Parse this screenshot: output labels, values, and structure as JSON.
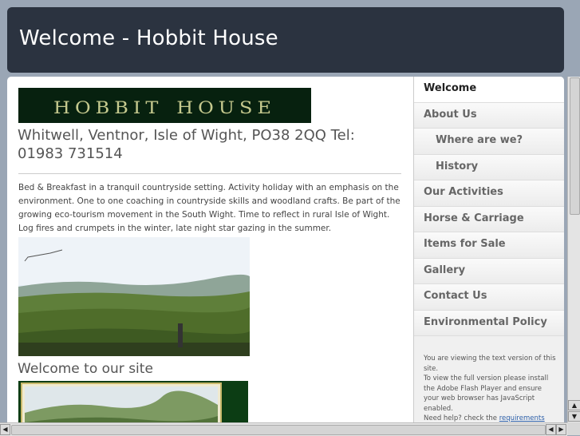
{
  "header": {
    "title": "Welcome - Hobbit House"
  },
  "logo": {
    "text": "hobbit house"
  },
  "address": "Whitwell, Ventnor, Isle of Wight, PO38 2QQ Tel: 01983 731514",
  "intro": "Bed & Breakfast in a tranquil countryside setting.  Activity holiday with an emphasis on the environment. One to one coaching in countryside skills and woodland crafts. Be part of the growing eco-tourism movement in the South Wight. Time to reflect in rural Isle of Wight. Log fires and crumpets in the winter, late night star gazing in the summer.",
  "welcome_heading": "Welcome to our site",
  "nav": [
    {
      "label": "Welcome",
      "active": true
    },
    {
      "label": "About Us"
    },
    {
      "label": "Where are we?",
      "sub": true
    },
    {
      "label": "History",
      "sub": true
    },
    {
      "label": "Our Activities"
    },
    {
      "label": "Horse & Carriage"
    },
    {
      "label": "Items for Sale"
    },
    {
      "label": "Gallery"
    },
    {
      "label": "Contact Us"
    },
    {
      "label": "Environmental Policy"
    }
  ],
  "flash_note": {
    "line1": "You are viewing the text version of this site.",
    "line2": "To view the full version please install the Adobe Flash Player and ensure your web browser has JavaScript enabled.",
    "line3_prefix": "Need help? check the ",
    "line3_link": "requirements"
  },
  "scroll_icons": {
    "up": "arrow-up-icon",
    "down": "arrow-down-icon",
    "left": "arrow-left-icon",
    "right": "arrow-right-icon"
  }
}
